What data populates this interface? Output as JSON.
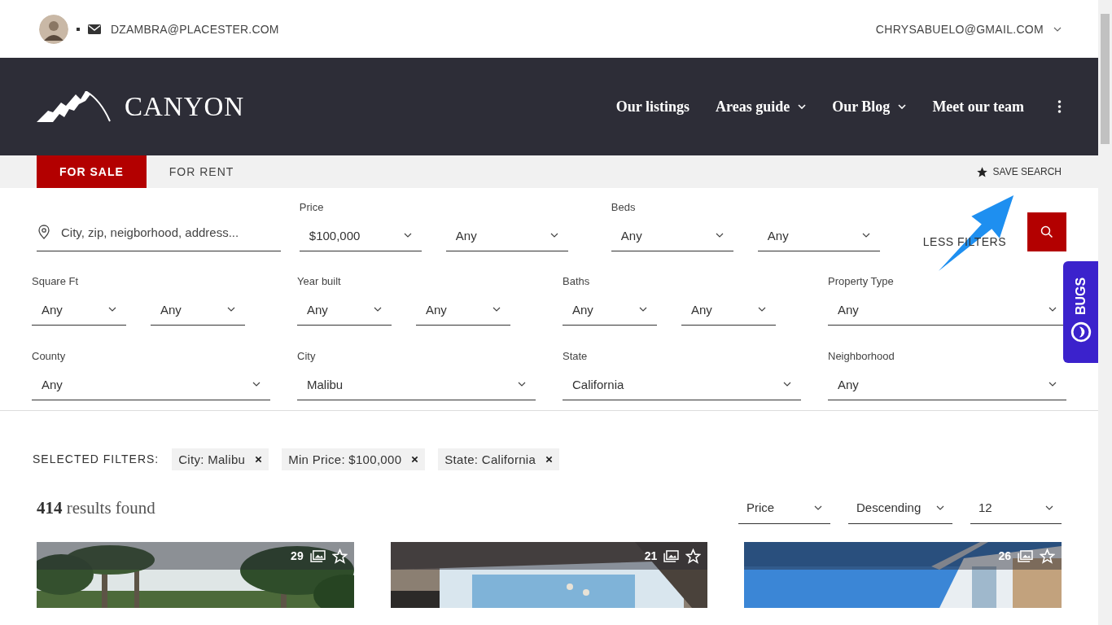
{
  "top_bar": {
    "contact_email": "DZAMBRA@PLACESTER.COM",
    "user_menu": "CHRYSABUELO@GMAIL.COM"
  },
  "header": {
    "logo": "CANYON",
    "nav": [
      {
        "label": "Our listings",
        "dropdown": false
      },
      {
        "label": "Areas guide",
        "dropdown": true
      },
      {
        "label": "Our Blog",
        "dropdown": true
      },
      {
        "label": "Meet our team",
        "dropdown": false
      }
    ]
  },
  "tabs": [
    {
      "label": "FOR SALE",
      "selected": true
    },
    {
      "label": "FOR RENT",
      "selected": false
    }
  ],
  "save_search": "SAVE SEARCH",
  "search": {
    "placeholder": "City, zip, neigborhood, address...",
    "less_filters": "LESS FILTERS"
  },
  "main_filters": [
    {
      "label": "Price",
      "values": [
        "$100,000",
        "Any"
      ]
    },
    {
      "label": "Beds",
      "values": [
        "Any",
        "Any"
      ]
    }
  ],
  "more_filters": [
    {
      "label": "Square Ft",
      "values": [
        "Any",
        "Any"
      ]
    },
    {
      "label": "Year built",
      "values": [
        "Any",
        "Any"
      ]
    },
    {
      "label": "Baths",
      "values": [
        "Any",
        "Any"
      ]
    },
    {
      "label": "Property Type",
      "values": [
        "Any"
      ]
    },
    {
      "label": "County",
      "values": [
        "Any"
      ]
    },
    {
      "label": "City",
      "values": [
        "Malibu"
      ]
    },
    {
      "label": "State",
      "values": [
        "California"
      ]
    },
    {
      "label": "Neighborhood",
      "values": [
        "Any"
      ]
    }
  ],
  "selected_filters": {
    "label": "SELECTED FILTERS:",
    "chips": [
      "City: Malibu",
      "Min Price: $100,000",
      "State: California"
    ]
  },
  "results": {
    "summary": "**414** results found",
    "sort": [
      "Price",
      "Descending",
      "12"
    ]
  },
  "listings": [
    {
      "photos": "29",
      "favorite": false,
      "kind": "palms"
    },
    {
      "photos": "21",
      "favorite": false,
      "kind": "interior"
    },
    {
      "photos": "26",
      "favorite": false,
      "kind": "modern"
    }
  ],
  "bugs_tab": "BUGS",
  "annotations": [
    {
      "kind": "arrow"
    }
  ]
}
